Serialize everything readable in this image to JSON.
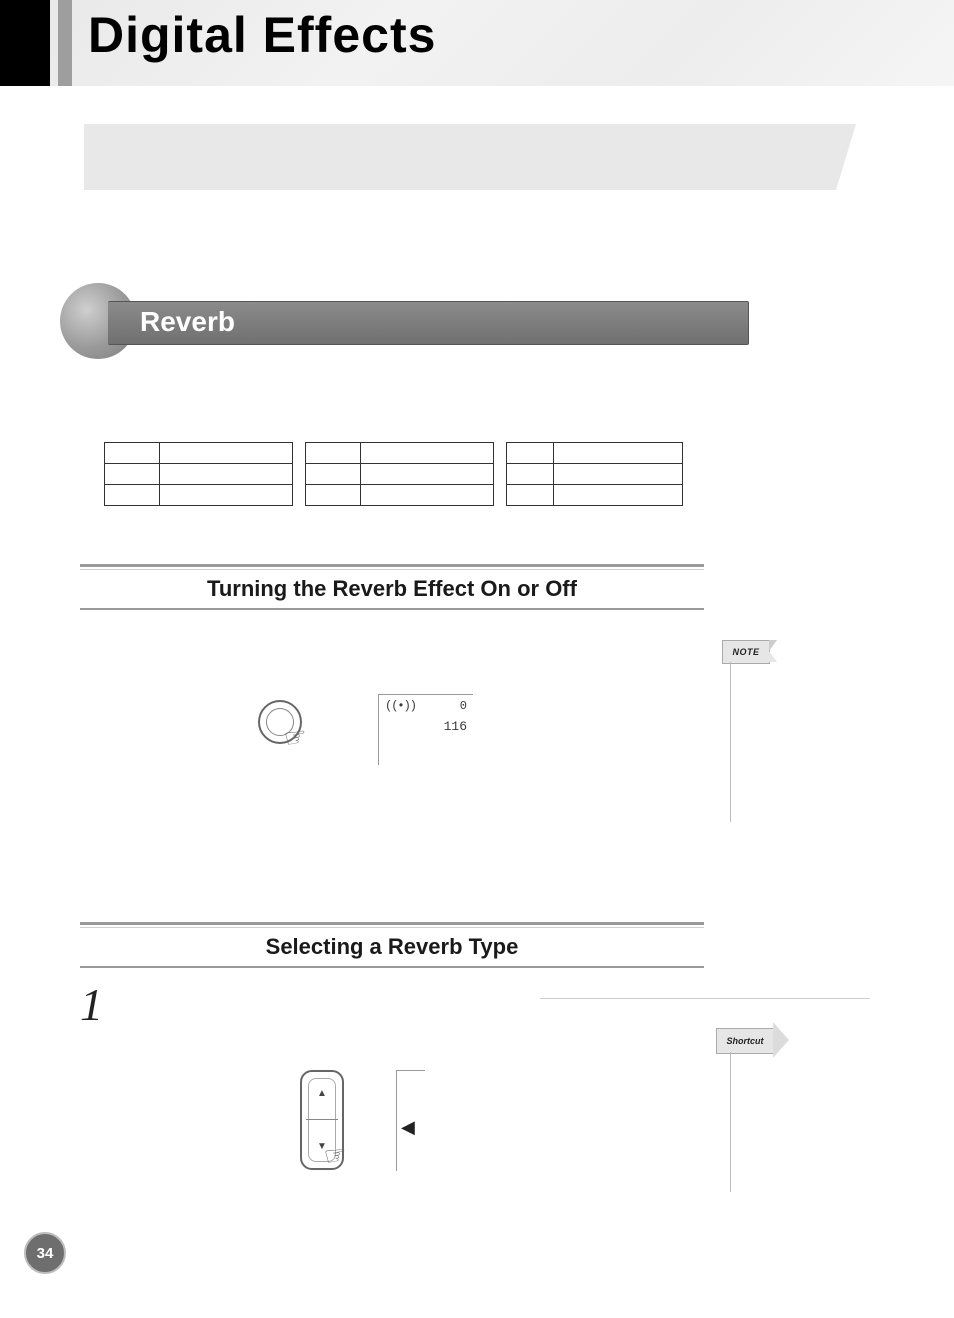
{
  "header_title": "Digital Effects",
  "reverb_heading": "Reverb",
  "sub1_title": "Turning the Reverb Effect On or Off",
  "sub2_title": "Selecting a Reverb Type",
  "note_label": "NOTE",
  "shortcut_label": "Shortcut",
  "lcd": {
    "val_top": "0",
    "val_bottom": "116"
  },
  "step_number": "1",
  "page_number": "34",
  "icons": {
    "hand": "☞",
    "reverb_waves": "((•))",
    "left_arrow": "◀",
    "tri_up": "▲",
    "tri_down": "▼"
  }
}
